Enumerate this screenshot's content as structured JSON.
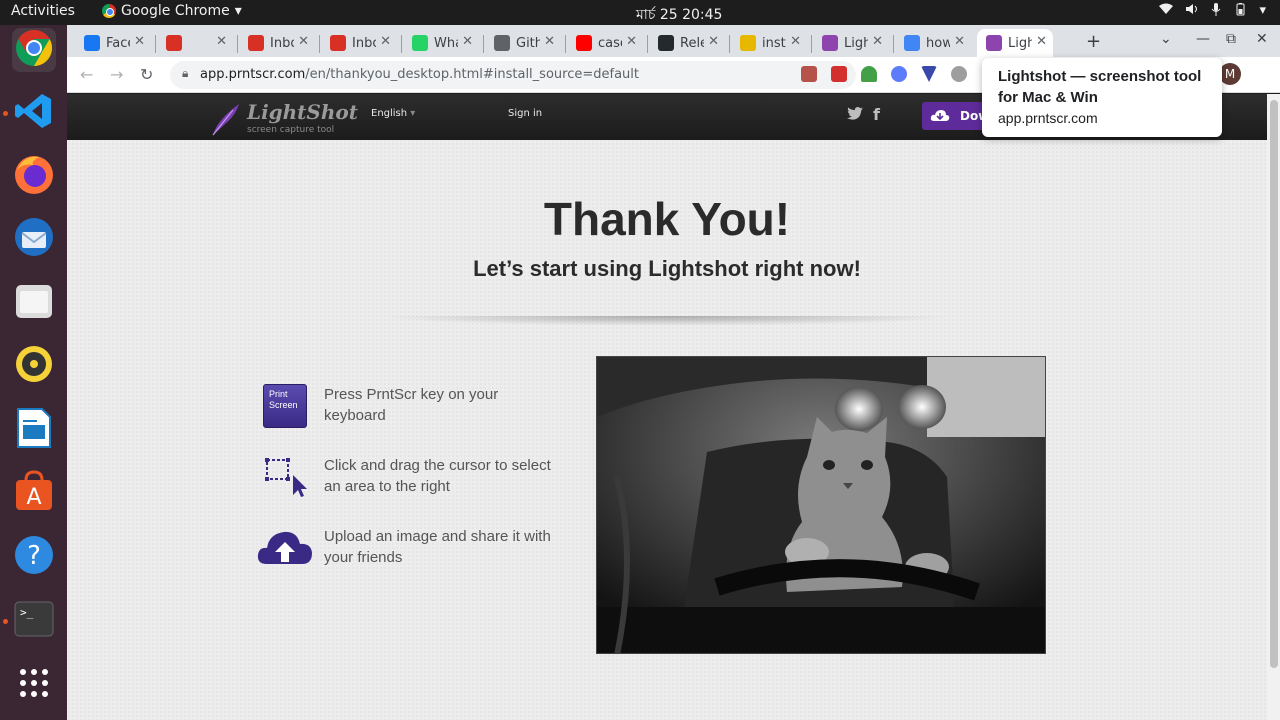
{
  "topbar": {
    "activities": "Activities",
    "app_name": "Google Chrome",
    "clock": "মার্চ 25  20:45"
  },
  "tabs": [
    {
      "label": "Face",
      "icon": "facebook-icon",
      "color": "#1877f2"
    },
    {
      "label": "",
      "icon": "drive-record-icon",
      "color": "#d93025"
    },
    {
      "label": "Inbo",
      "icon": "gmail-icon",
      "color": "#d93025"
    },
    {
      "label": "Inbo",
      "icon": "gmail-icon",
      "color": "#d93025"
    },
    {
      "label": "Wha",
      "icon": "whatsapp-icon",
      "color": "#25d366"
    },
    {
      "label": "Gith",
      "icon": "globe-icon",
      "color": "#5f6368"
    },
    {
      "label": "case",
      "icon": "youtube-icon",
      "color": "#ff0000"
    },
    {
      "label": "Rele",
      "icon": "github-icon",
      "color": "#24292e"
    },
    {
      "label": "inst",
      "icon": "yandex-icon",
      "color": "#e6b800"
    },
    {
      "label": "Ligh",
      "icon": "lightshot-feather-icon",
      "color": "#8e44ad"
    },
    {
      "label": "how",
      "icon": "google-icon",
      "color": "#4285f4"
    },
    {
      "label": "Ligh",
      "icon": "lightshot-feather-icon",
      "color": "#8e44ad",
      "active": true
    }
  ],
  "address": {
    "host": "app.prntscr.com",
    "path": "/en/thankyou_desktop.html#install_source=default"
  },
  "profile_initial": "M",
  "tooltip": {
    "title": "Lightshot — screenshot tool for Mac & Win",
    "url": "app.prntscr.com"
  },
  "site": {
    "logo_name": "LightShot",
    "logo_tagline": "screen capture tool",
    "language": "English",
    "signin": "Sign in",
    "download": "Download",
    "brand_color": "#5e2c9a"
  },
  "main": {
    "title": "Thank You!",
    "subtitle": "Let’s start using Lightshot right now!",
    "steps": [
      {
        "icon": "print-screen-key-icon",
        "key_label": "Print Screen",
        "text": "Press PrntScr key on your keyboard"
      },
      {
        "icon": "select-area-cursor-icon",
        "text": "Click and drag the cursor to select an area to the right"
      },
      {
        "icon": "cloud-upload-icon",
        "text": "Upload an image and share it with your friends"
      }
    ]
  }
}
